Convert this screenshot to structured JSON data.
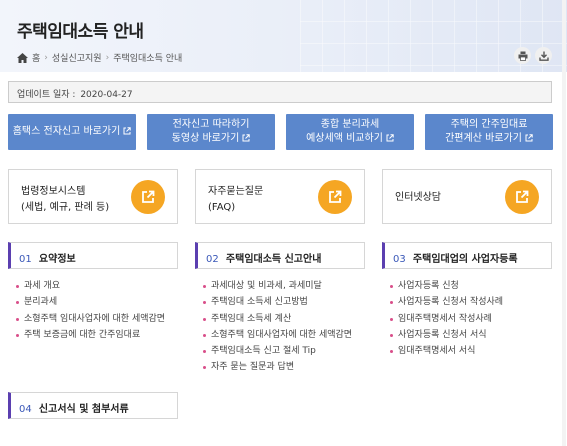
{
  "page": {
    "title": "주택임대소득 안내"
  },
  "breadcrumb": {
    "home": "홈",
    "level1": "성실신고지원",
    "level2": "주택임대소득 안내"
  },
  "tools": {
    "print_icon": "printer-icon",
    "download_icon": "download-icon"
  },
  "update": {
    "label": "업데이트 일자 :",
    "date": "2020-04-27"
  },
  "buttons": [
    {
      "line1": "홈택스 전자신고 바로가기",
      "line2": ""
    },
    {
      "line1": "전자신고 따라하기",
      "line2": "동영상 바로가기"
    },
    {
      "line1": "종합 분리과세",
      "line2": "예상세액 비교하기"
    },
    {
      "line1": "주택의 간주임대료",
      "line2": "간편계산 바로가기"
    }
  ],
  "cards": [
    {
      "line1": "법령정보시스템",
      "line2": "(세법, 예규, 판례 등)"
    },
    {
      "line1": "자주묻는질문",
      "line2": "(FAQ)"
    },
    {
      "line1": "인터넷상담",
      "line2": ""
    }
  ],
  "sections": [
    {
      "num": "01",
      "title": "요약정보",
      "items": [
        "과세 개요",
        "분리과세",
        "소형주택 임대사업자에 대한 세액감면",
        "주택 보증금에 대한 간주임대료"
      ]
    },
    {
      "num": "02",
      "title": "주택임대소득 신고안내",
      "items": [
        "과세대상 및 비과세, 과세미달",
        "주택임대 소득세 신고방법",
        "주택임대 소득세 계산",
        "소형주택 임대사업자에 대한 세액감면",
        "주택임대소득 신고 절세 Tip",
        "자주 묻는 질문과 답변"
      ]
    },
    {
      "num": "03",
      "title": "주택임대업의 사업자등록",
      "items": [
        "사업자등록 신청",
        "사업자등록 신청서 작성사례",
        "임대주택명세서 작성사례",
        "사업자등록 신청서 서식",
        "임대주택명세서 서식"
      ]
    },
    {
      "num": "04",
      "title": "신고서식 및 첨부서류",
      "items": []
    }
  ],
  "colors": {
    "accent_blue": "#5b87cc",
    "accent_orange": "#f5a623",
    "section_bar": "#5b3fb0",
    "bullet": "#d94f8a"
  }
}
